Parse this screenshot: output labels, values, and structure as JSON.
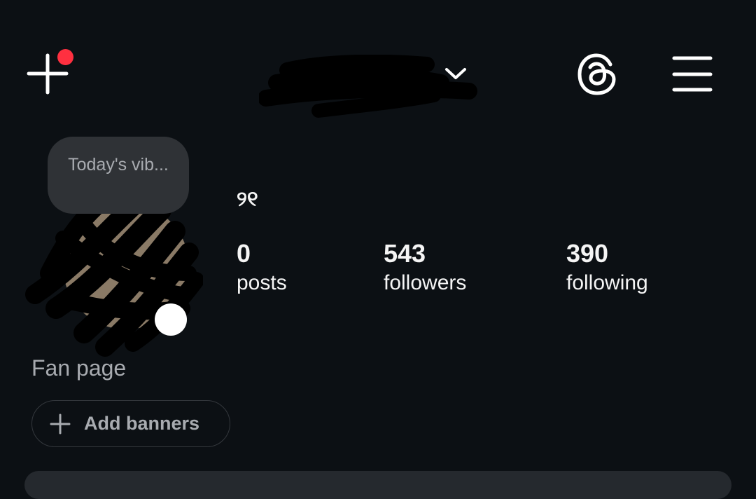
{
  "header": {
    "create_icon": "plus-icon",
    "notification_color": "#ff3040",
    "dropdown_icon": "chevron-down-icon",
    "threads_icon": "threads-icon",
    "menu_icon": "hamburger-menu-icon"
  },
  "profile": {
    "note_text": "Today's vib...",
    "display_name": "୨୧",
    "category": "Fan page",
    "add_banners_label": "Add banners",
    "add_banners_icon": "plus-icon"
  },
  "stats": [
    {
      "value": "0",
      "label": "posts"
    },
    {
      "value": "543",
      "label": "followers"
    },
    {
      "value": "390",
      "label": "following"
    }
  ],
  "colors": {
    "background": "#0c1014",
    "card": "#25292e",
    "muted_text": "#a8abb0"
  }
}
